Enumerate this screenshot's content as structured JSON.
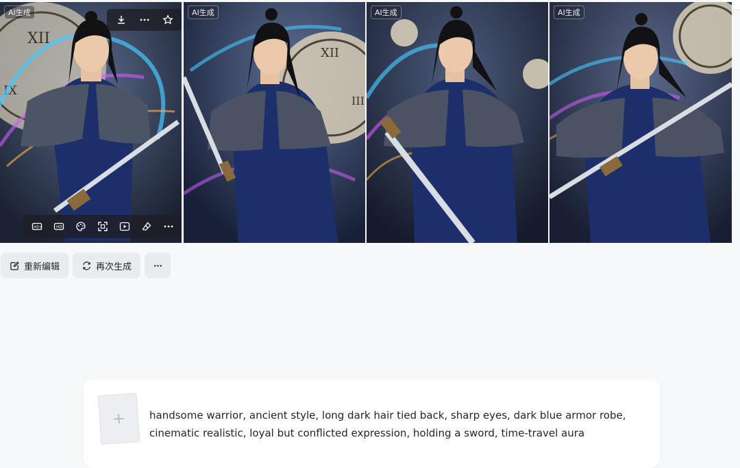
{
  "gallery": {
    "badge_label": "AI生成",
    "images": [
      {
        "name": "warrior-image-1"
      },
      {
        "name": "warrior-image-2"
      },
      {
        "name": "warrior-image-3"
      },
      {
        "name": "warrior-image-4"
      }
    ],
    "top_toolbar": {
      "icons": [
        "download-icon",
        "more-dots-icon",
        "star-icon"
      ]
    },
    "bottom_toolbar": {
      "icons": [
        "hd-plus-icon",
        "hd-icon",
        "palette-icon",
        "expand-icon",
        "play-icon",
        "eraser-icon",
        "more-dots-icon"
      ]
    }
  },
  "actions": {
    "reedit_label": "重新编辑",
    "regenerate_label": "再次生成",
    "more_label": "···"
  },
  "prompt": {
    "add_glyph": "+",
    "text": "handsome warrior, ancient style, long dark hair tied back, sharp eyes, dark blue armor robe, cinematic realistic, loyal but conflicted expression, holding a sword, time-travel aura"
  },
  "colors": {
    "page_bg": "#f7f8fa",
    "armor_blue": "#1c2f6b",
    "aura_cyan": "#46c8ff",
    "aura_magenta": "#d05cff"
  }
}
